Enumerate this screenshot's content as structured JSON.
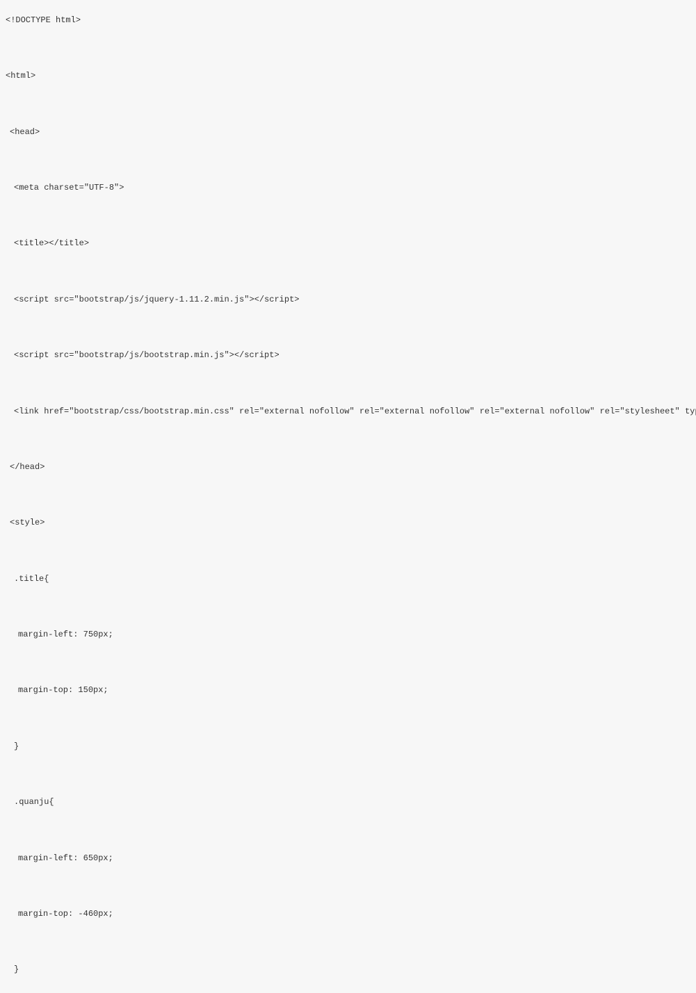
{
  "code": {
    "l1": "<!DOCTYPE html>",
    "l2": "<html>",
    "l3": "<head>",
    "l4": "<meta charset=\"UTF-8\">",
    "l5": "<title></title>",
    "l6": "<script src=\"bootstrap/js/jquery-1.11.2.min.js\"></script>",
    "l7": "<script src=\"bootstrap/js/bootstrap.min.js\"></script>",
    "l8": "<link href=\"bootstrap/css/bootstrap.min.css\" rel=\"external nofollow\" rel=\"external nofollow\" rel=\"external nofollow\" rel=\"stylesheet\" type=\"text/css\"/>",
    "l9": "</head>",
    "l10": "<style>",
    "l11": ".title{",
    "l12": "margin-left: 750px;",
    "l13": "margin-top: 150px;",
    "l14": "}",
    "l15": ".quanju{",
    "l16": "margin-left: 650px;",
    "l17": "margin-top: -460px;",
    "l18": "}"
  }
}
